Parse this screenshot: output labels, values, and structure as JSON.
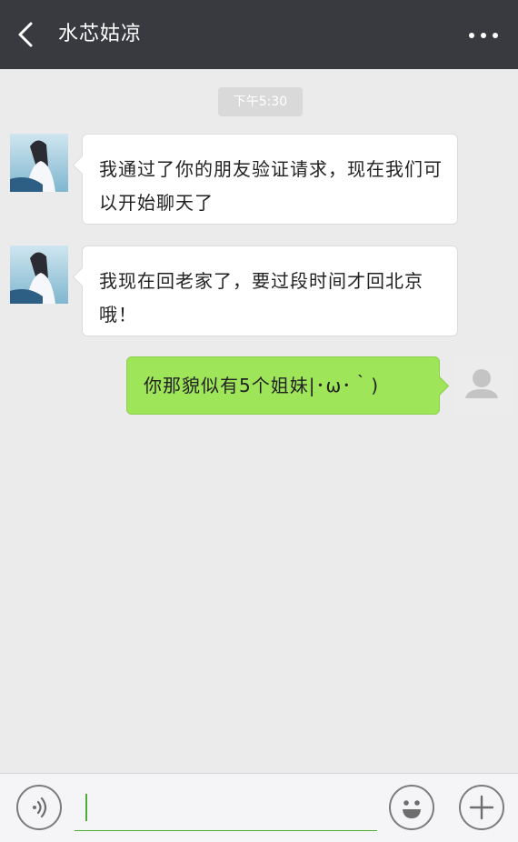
{
  "header": {
    "title": "水芯姑凉",
    "back_icon": "chevron-left-icon",
    "more_icon": "more-dots-icon",
    "background": "#393a3f"
  },
  "chat": {
    "timestamp": "下午5:30",
    "messages": [
      {
        "sender": "contact",
        "text": "我通过了你的朋友验证请求，现在我们可以开始聊天了"
      },
      {
        "sender": "contact",
        "text": "我现在回老家了，要过段时间才回北京哦！"
      },
      {
        "sender": "me",
        "text": "你那貌似有5个姐妹|･ω･｀)"
      }
    ]
  },
  "input_bar": {
    "voice_icon": "voice-icon",
    "emoji_icon": "emoji-icon",
    "plus_icon": "plus-icon",
    "input_value": "",
    "accent_color": "#4caf2f"
  },
  "colors": {
    "chat_bg": "#ebebeb",
    "outgoing_bubble": "#9fe55a",
    "incoming_bubble": "#ffffff"
  }
}
